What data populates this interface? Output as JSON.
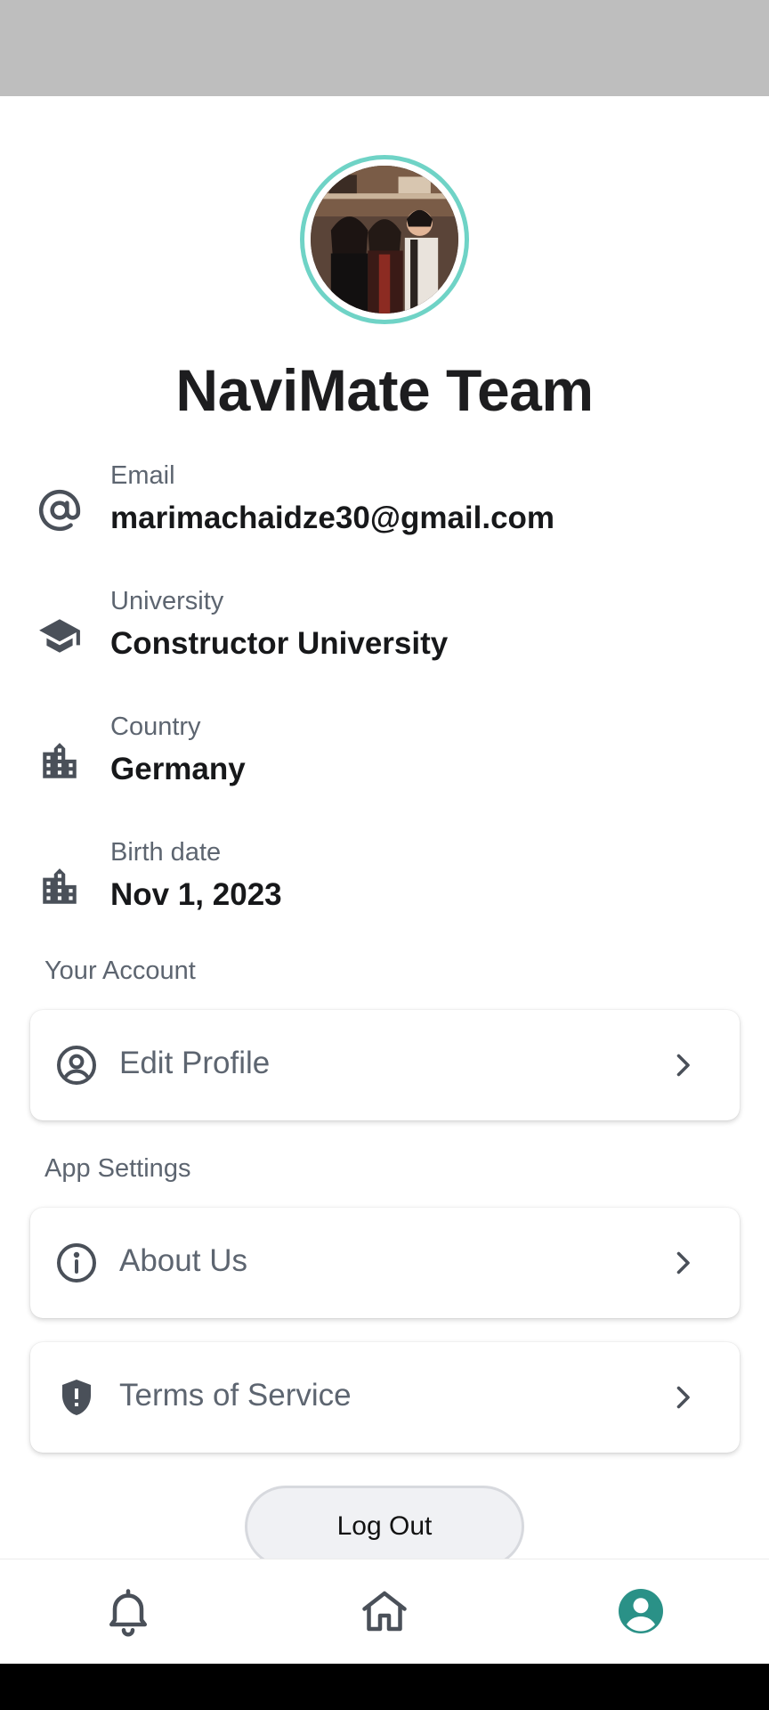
{
  "profile": {
    "name": "NaviMate Team"
  },
  "info": {
    "email": {
      "label": "Email",
      "value": "marimachaidze30@gmail.com",
      "icon": "at-icon"
    },
    "university": {
      "label": "University",
      "value": "Constructor University",
      "icon": "graduation-cap-icon"
    },
    "country": {
      "label": "Country",
      "value": "Germany",
      "icon": "building-icon"
    },
    "birth_date": {
      "label": "Birth date",
      "value": "Nov 1, 2023",
      "icon": "building-icon"
    }
  },
  "sections": {
    "account_title": "Your Account",
    "app_settings_title": "App Settings"
  },
  "menu": {
    "edit_profile": "Edit Profile",
    "about_us": "About Us",
    "terms_of_service": "Terms of Service"
  },
  "logout_label": "Log Out",
  "nav": {
    "items": [
      "bell-icon",
      "home-icon",
      "profile-icon"
    ],
    "active": "profile-icon"
  },
  "colors": {
    "accent": "#2a9187",
    "avatar_ring": "#6fd3c6",
    "icon_gray": "#4a5059"
  }
}
